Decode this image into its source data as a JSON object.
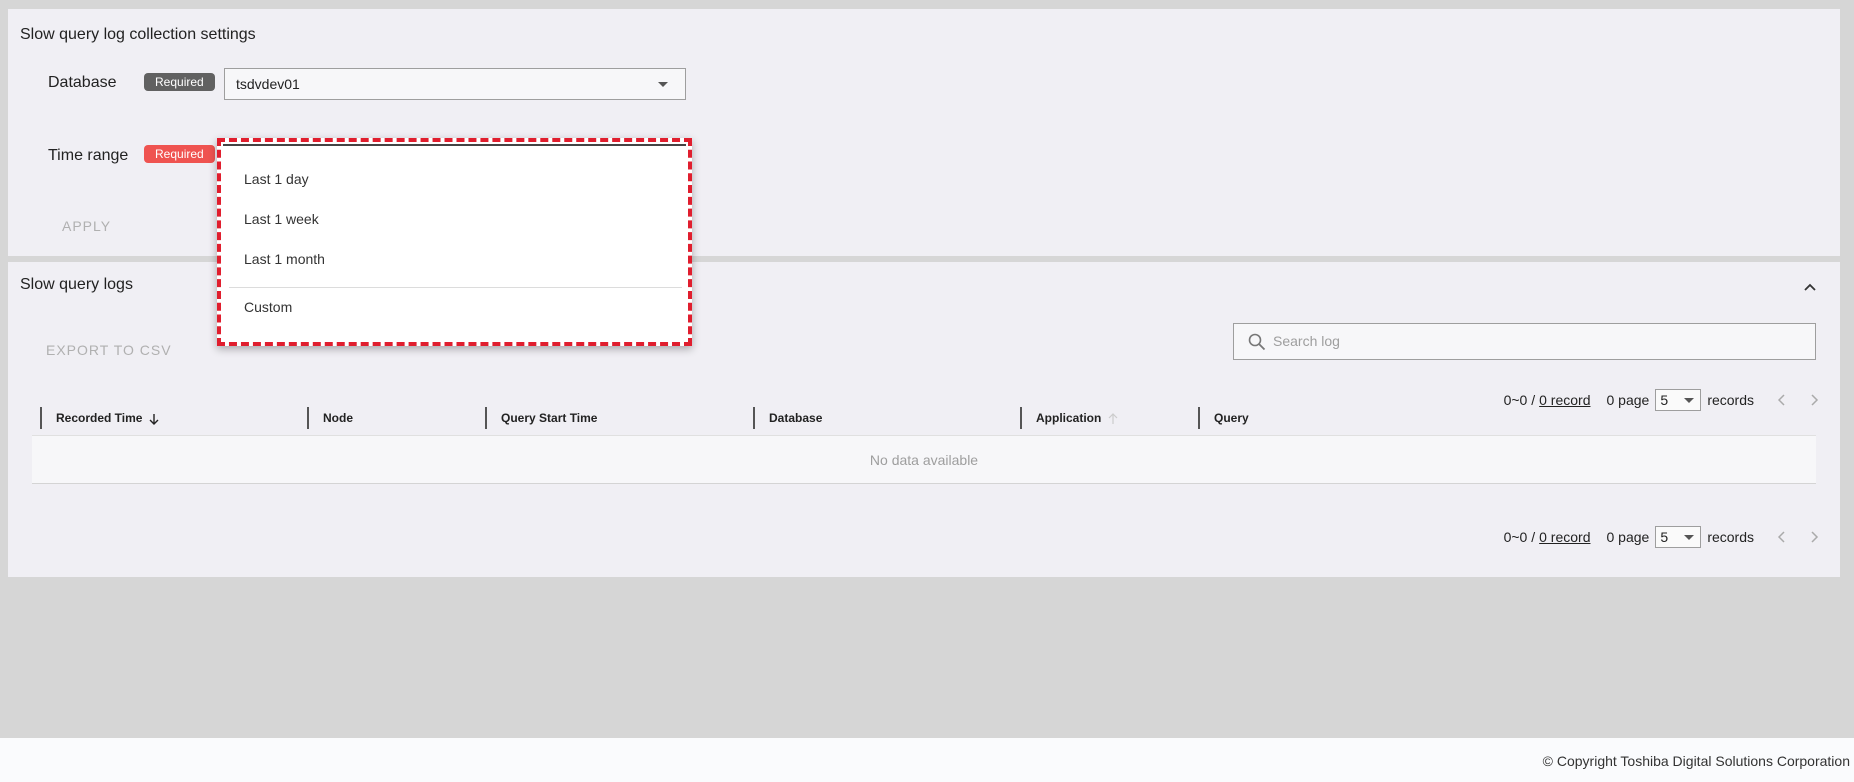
{
  "settings": {
    "title": "Slow query log collection settings",
    "database_label": "Database",
    "required_badge": "Required",
    "database_value": "tsdvdev01",
    "time_range_label": "Time range",
    "apply_label": "APPLY"
  },
  "time_range_dropdown": {
    "options": [
      "Last 1 day",
      "Last 1 week",
      "Last 1 month"
    ],
    "custom_option": "Custom"
  },
  "logs": {
    "title": "Slow query logs",
    "export_label": "EXPORT TO CSV",
    "search_placeholder": "Search log",
    "pager": {
      "range": "0~0 /",
      "record_link": "0 record",
      "page_text": "0 page",
      "page_size": "5",
      "records_text": "records"
    },
    "columns": [
      "Recorded Time",
      "Node",
      "Query Start Time",
      "Database",
      "Application",
      "Query"
    ],
    "empty_text": "No data available"
  },
  "footer": {
    "copyright": "© Copyright Toshiba Digital Solutions Corporation"
  },
  "colors": {
    "required_gray": "#616161",
    "required_red": "#ef5350",
    "highlight": "#e01e2e"
  }
}
